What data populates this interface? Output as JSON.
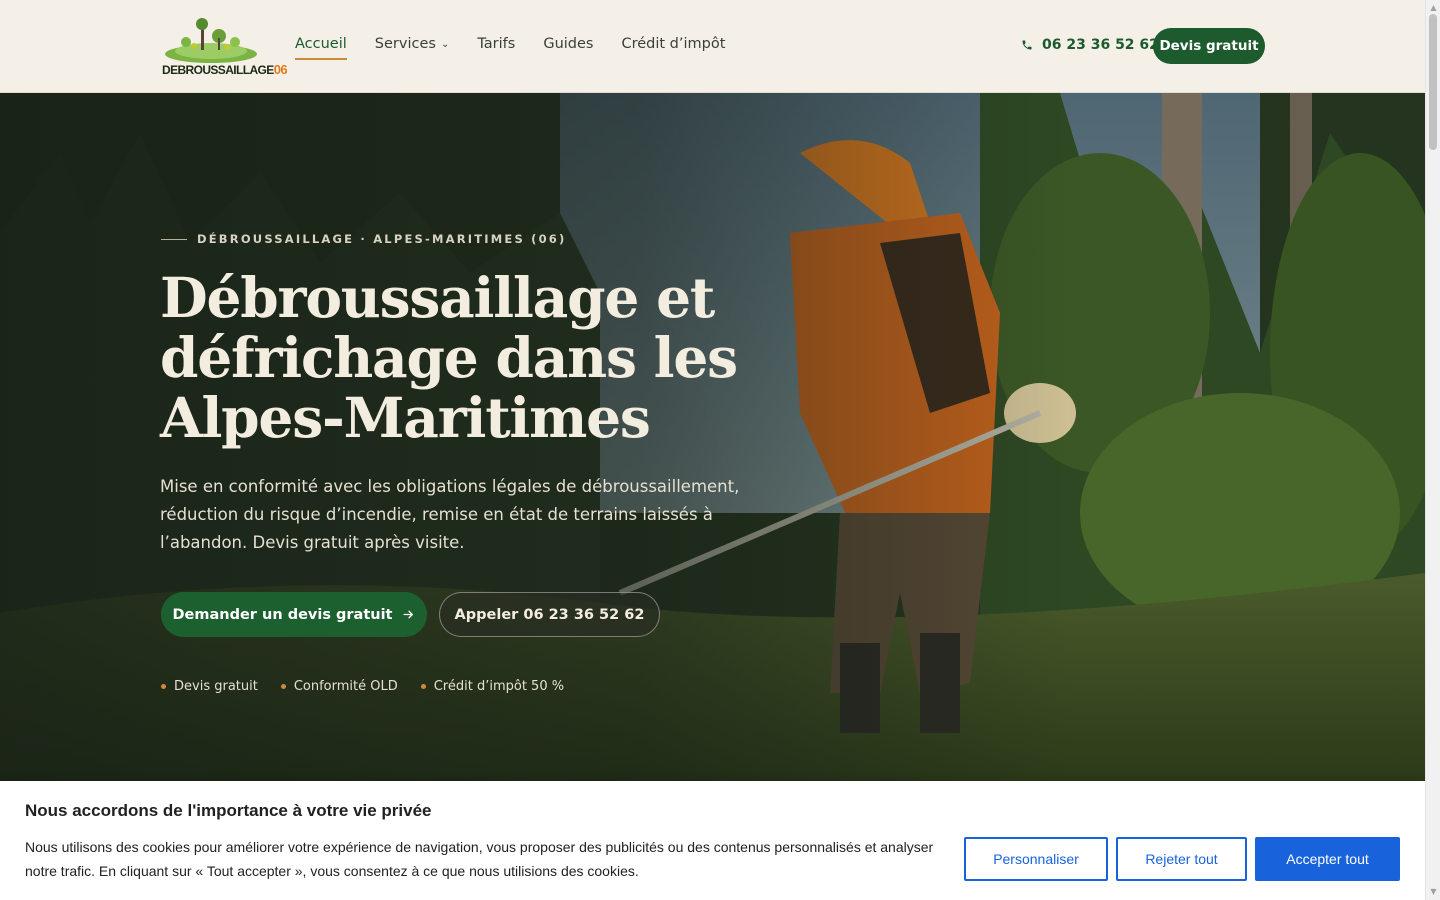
{
  "header": {
    "logo_text": "DEBROUSSAILLAGE",
    "logo_number": "06",
    "nav": [
      {
        "label": "Accueil",
        "active": true
      },
      {
        "label": "Services",
        "dropdown": true
      },
      {
        "label": "Tarifs"
      },
      {
        "label": "Guides"
      },
      {
        "label": "Crédit d’impôt"
      }
    ],
    "phone": "06 23 36 52 62",
    "cta": "Devis gratuit"
  },
  "hero": {
    "eyebrow": "DÉBROUSSAILLAGE · ALPES-MARITIMES (06)",
    "title": "Débroussaillage et défrichage dans les Alpes-Maritimes",
    "subtitle": "Mise en conformité avec les obligations légales de débroussaillement, réduction du risque d’incendie, remise en état de terrains laissés à l’abandon. Devis gratuit après visite.",
    "primary_button": "Demander un devis gratuit",
    "secondary_button": "Appeler 06 23 36 52 62",
    "badges": [
      "Devis gratuit",
      "Conformité OLD",
      "Crédit d’impôt 50 %"
    ]
  },
  "cookie": {
    "title": "Nous accordons de l'importance à votre vie privée",
    "text": "Nous utilisons des cookies pour améliorer votre expérience de navigation, vous proposer des publicités ou des contenus personnalisés et analyser notre trafic. En cliquant sur « Tout accepter », vous consentez à ce que nous utilisions des cookies.",
    "customize": "Personnaliser",
    "reject": "Rejeter tout",
    "accept": "Accepter tout"
  },
  "colors": {
    "brand_green": "#1d5a2e",
    "accent_orange": "#c98a3c",
    "cookie_blue": "#1863dc",
    "header_bg": "#f4f0e8"
  }
}
